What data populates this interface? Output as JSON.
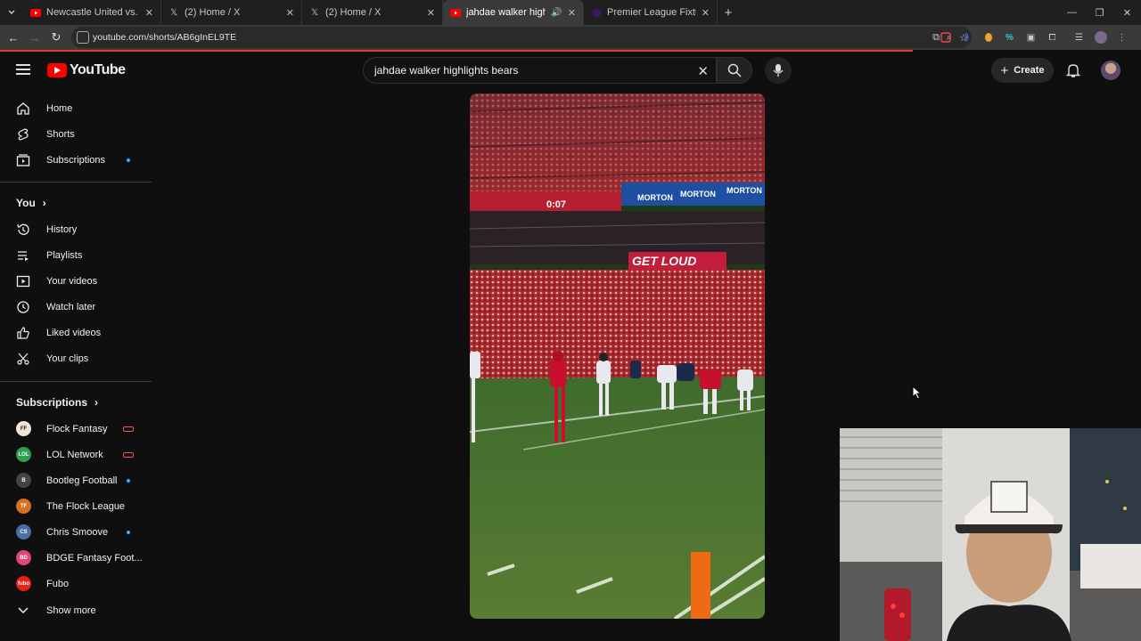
{
  "browser": {
    "tabs": [
      {
        "title": "Newcastle United vs. Liverpool",
        "favicon": "youtube-icon",
        "active": false
      },
      {
        "title": "(2) Home / X",
        "favicon": "x-icon",
        "active": false
      },
      {
        "title": "(2) Home / X",
        "favicon": "x-icon",
        "active": false
      },
      {
        "title": "jahdae walker highlights be",
        "favicon": "youtube-icon",
        "active": true
      },
      {
        "title": "Premier League Fixtures & Live",
        "favicon": "premier-league-icon",
        "active": false
      }
    ],
    "url": "youtube.com/shorts/AB6gInEL9TE"
  },
  "header": {
    "logo_text": "YouTube",
    "search_value": "jahdae walker highlights bears",
    "create_label": "Create"
  },
  "sidebar": {
    "main_items": [
      {
        "label": "Home",
        "icon": "home-icon"
      },
      {
        "label": "Shorts",
        "icon": "shorts-icon"
      },
      {
        "label": "Subscriptions",
        "icon": "subscriptions-icon"
      }
    ],
    "you_heading": "You",
    "you_items": [
      {
        "label": "History",
        "icon": "history-icon"
      },
      {
        "label": "Playlists",
        "icon": "playlists-icon"
      },
      {
        "label": "Your videos",
        "icon": "your-videos-icon"
      },
      {
        "label": "Watch later",
        "icon": "watch-later-icon"
      },
      {
        "label": "Liked videos",
        "icon": "liked-videos-icon"
      },
      {
        "label": "Your clips",
        "icon": "clips-icon"
      }
    ],
    "subs_heading": "Subscriptions",
    "subscriptions": [
      {
        "label": "Flock Fantasy",
        "status": "live",
        "color": "#f0e6d2"
      },
      {
        "label": "LOL Network",
        "status": "live",
        "color": "#2e9e4f"
      },
      {
        "label": "Bootleg Football",
        "status": "new",
        "color": "#444444"
      },
      {
        "label": "The Flock League",
        "status": "none",
        "color": "#d4731f"
      },
      {
        "label": "Chris Smoove",
        "status": "new",
        "color": "#4a6fa5"
      },
      {
        "label": "BDGE Fantasy Foot...",
        "status": "none",
        "color": "#e0457b"
      },
      {
        "label": "Fubo",
        "status": "none",
        "color": "#e62117"
      }
    ],
    "show_more": "Show more"
  },
  "video": {
    "scoreboard": "0:07",
    "sponsor": "MORTON",
    "banner": "GET LOUD"
  }
}
